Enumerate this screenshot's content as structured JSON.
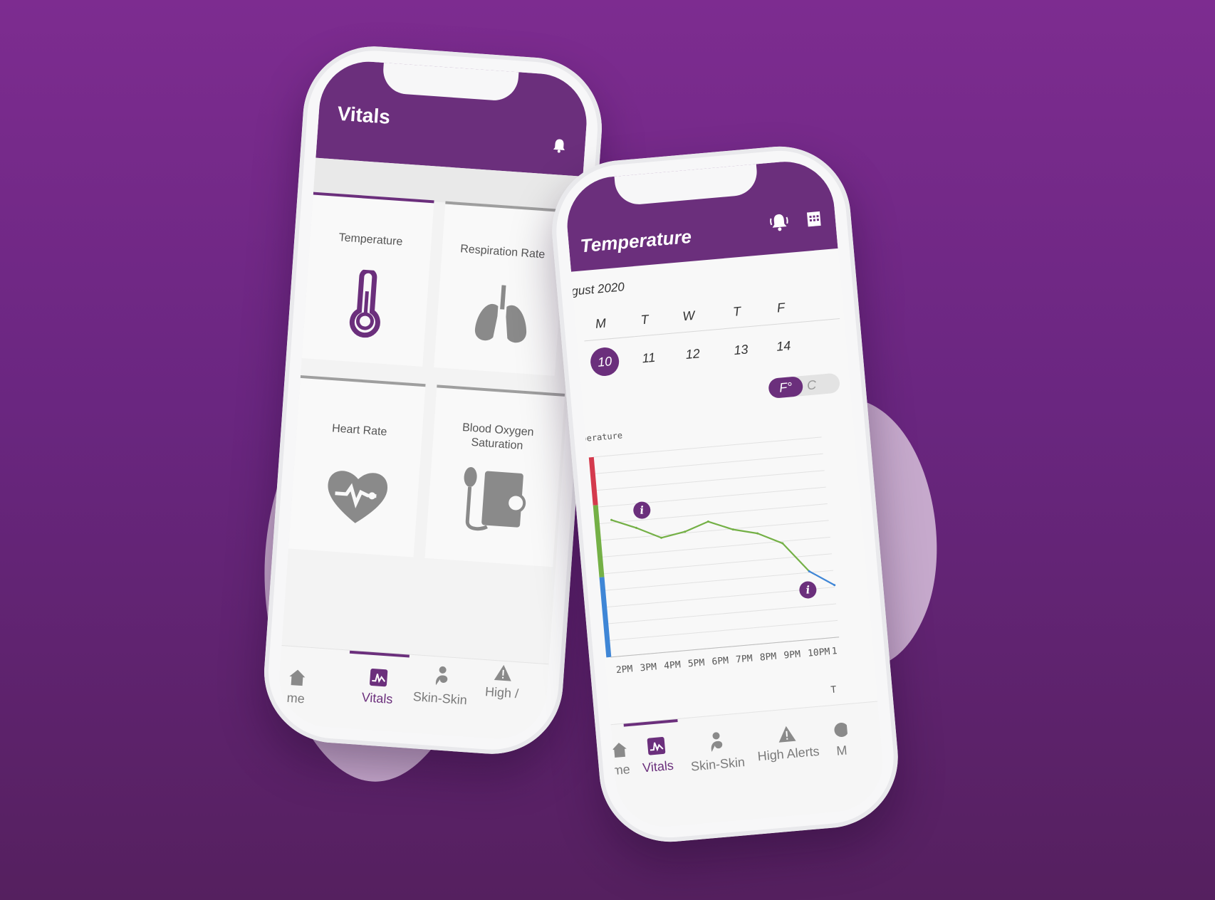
{
  "colors": {
    "brand": "#6b2f7c",
    "background": "#7d2c90",
    "high": "#d43a4d",
    "normal": "#74b046",
    "low": "#3f86d6"
  },
  "left_phone": {
    "header": {
      "title": "Vitals",
      "bell_icon": "bell-icon"
    },
    "tiles": [
      {
        "label": "Temperature",
        "icon": "thermometer-icon"
      },
      {
        "label": "Respiration Rate",
        "icon": "lungs-icon"
      },
      {
        "label": "Heart Rate",
        "icon": "heart-rate-icon"
      },
      {
        "label": "Blood Oxygen Saturation",
        "label_line1": "Blood Oxygen",
        "label_line2": "Saturation",
        "icon": "blood-pressure-icon"
      }
    ],
    "nav": [
      {
        "label": "me",
        "icon": "home-icon"
      },
      {
        "label": "Vitals",
        "icon": "vitals-icon",
        "active": true
      },
      {
        "label": "Skin-Skin",
        "icon": "skin-skin-icon"
      },
      {
        "label": "High /",
        "icon": "alert-icon"
      }
    ]
  },
  "right_phone": {
    "header": {
      "title": "Temperature",
      "bell_icon": "bell-ringing-icon",
      "calendar_icon": "calendar-icon"
    },
    "calendar": {
      "month": "gust 2020",
      "weekdays": [
        "M",
        "T",
        "W",
        "T",
        "F"
      ],
      "dates": [
        "10",
        "11",
        "12",
        "13",
        "14"
      ],
      "selected": "10"
    },
    "unit_toggle": {
      "selected": "F°",
      "other": "C"
    },
    "chart_data": {
      "type": "line",
      "title": "perature",
      "x": [
        "2PM",
        "3PM",
        "4PM",
        "5PM",
        "6PM",
        "7PM",
        "8PM",
        "9PM",
        "10PM",
        "1"
      ],
      "x_caption": "T",
      "series": [
        {
          "values": [
            6.8,
            6.3,
            5.7,
            5.9,
            6.3,
            5.8,
            5.5,
            4.9,
            3.4,
            2.6
          ]
        }
      ],
      "ylim": [
        0,
        10
      ],
      "grid": true,
      "range_bands": [
        {
          "color": "#d43a4d",
          "from": 7.6,
          "to": 11
        },
        {
          "color": "#74b046",
          "from": 4.0,
          "to": 7.6
        },
        {
          "color": "#3f86d6",
          "from": 0,
          "to": 4.0
        }
      ],
      "info_markers": [
        "i",
        "i"
      ]
    },
    "nav": [
      {
        "label": "me",
        "icon": "home-icon"
      },
      {
        "label": "Vitals",
        "icon": "vitals-icon",
        "active": true
      },
      {
        "label": "Skin-Skin",
        "icon": "skin-skin-icon"
      },
      {
        "label": "High Alerts",
        "icon": "alert-icon"
      },
      {
        "label": "M",
        "icon": "more-icon"
      }
    ]
  }
}
